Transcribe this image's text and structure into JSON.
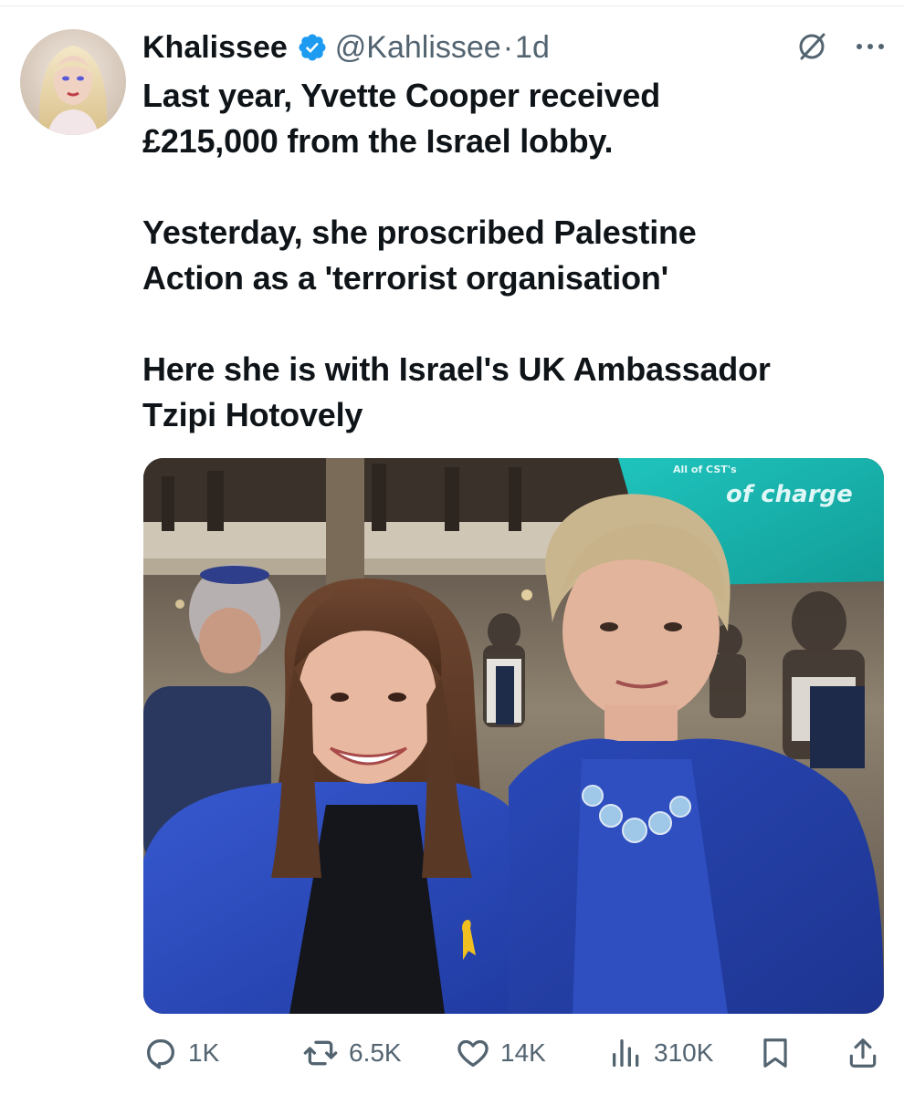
{
  "tweet": {
    "author": {
      "display_name": "Khalissee",
      "handle": "@Kahlissee",
      "verified": true,
      "avatar_icon": "profile-photo"
    },
    "separator": "·",
    "time": "1d",
    "header_icons": [
      "grok-icon",
      "more-icon"
    ],
    "text": {
      "line1": "Last year, Yvette Cooper received",
      "line2": "£215,000 from the Israel lobby.",
      "line3": "Yesterday, she proscribed Palestine",
      "line4": "Action as a 'terrorist organisation'",
      "line5": "Here she is with Israel's UK Ambassador",
      "line6": "Tzipi Hotovely"
    },
    "media": {
      "screen_text_top": "All of CST's",
      "screen_text_main": "of charge"
    },
    "stats": {
      "replies": "1K",
      "reposts": "6.5K",
      "likes": "14K",
      "views": "310K"
    },
    "colors": {
      "verified_blue": "#1d9bf0",
      "secondary_text": "#536471",
      "primary_text": "#0f1419",
      "screen_teal": "#19b7b0",
      "jacket_blue": "#2b4db8"
    }
  }
}
